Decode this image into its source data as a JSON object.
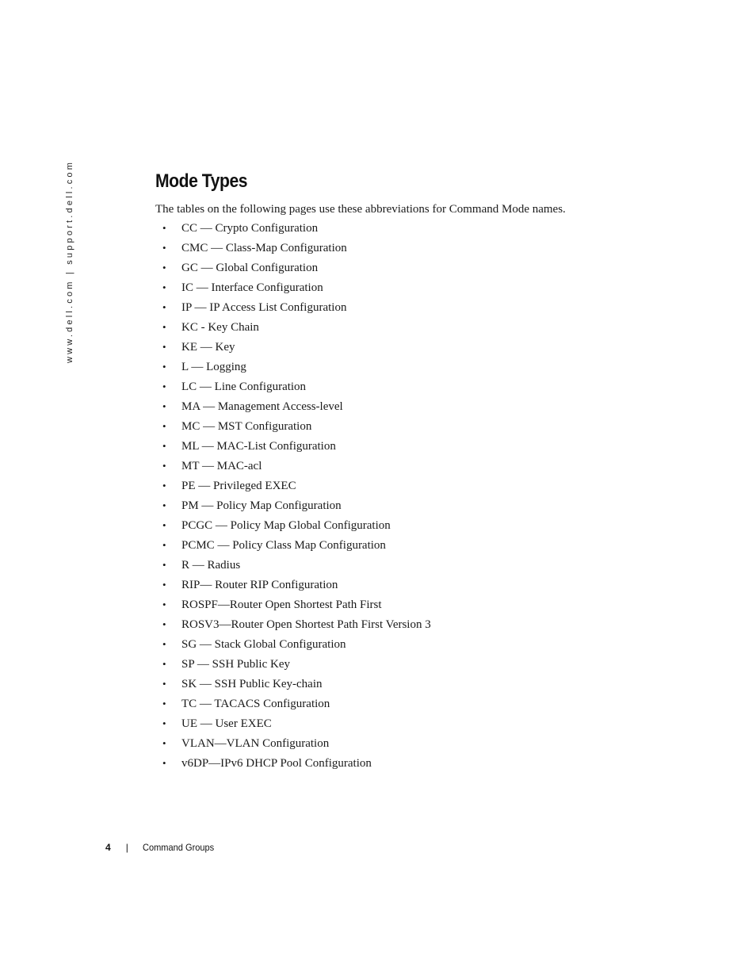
{
  "sidebar": {
    "url_text": "www.dell.com | support.dell.com"
  },
  "heading": {
    "title": "Mode Types",
    "intro": "The tables on the following pages use these abbreviations for Command Mode names."
  },
  "modes": [
    {
      "text": "CC — Crypto Configuration"
    },
    {
      "text": "CMC — Class-Map Configuration"
    },
    {
      "text": "GC — Global Configuration"
    },
    {
      "text": "IC — Interface Configuration"
    },
    {
      "text": "IP — IP Access List Configuration"
    },
    {
      "text": "KC - Key Chain"
    },
    {
      "text": "KE — Key"
    },
    {
      "text": "L — Logging"
    },
    {
      "text": "LC — Line Configuration"
    },
    {
      "text": "MA — Management Access-level"
    },
    {
      "text": "MC — MST Configuration"
    },
    {
      "text": "ML — MAC-List Configuration"
    },
    {
      "text": "MT — MAC-acl"
    },
    {
      "text": "PE — Privileged EXEC"
    },
    {
      "text": "PM — Policy Map Configuration"
    },
    {
      "text": "PCGC — Policy Map Global Configuration"
    },
    {
      "text": "PCMC — Policy Class Map Configuration"
    },
    {
      "text": "R — Radius"
    },
    {
      "text": "RIP— Router RIP Configuration"
    },
    {
      "text": "ROSPF—Router Open Shortest Path First"
    },
    {
      "text": "ROSV3—Router Open Shortest Path First Version 3"
    },
    {
      "text": "SG — Stack Global Configuration"
    },
    {
      "text": "SP — SSH Public Key"
    },
    {
      "text": "SK — SSH Public Key-chain"
    },
    {
      "text": "TC — TACACS Configuration"
    },
    {
      "text": "UE — User EXEC"
    },
    {
      "text": "VLAN—VLAN Configuration"
    },
    {
      "text": "v6DP—IPv6 DHCP Pool Configuration"
    }
  ],
  "bullet_glyph": "•",
  "footer": {
    "page_number": "4",
    "separator": "|",
    "section": "Command Groups"
  }
}
